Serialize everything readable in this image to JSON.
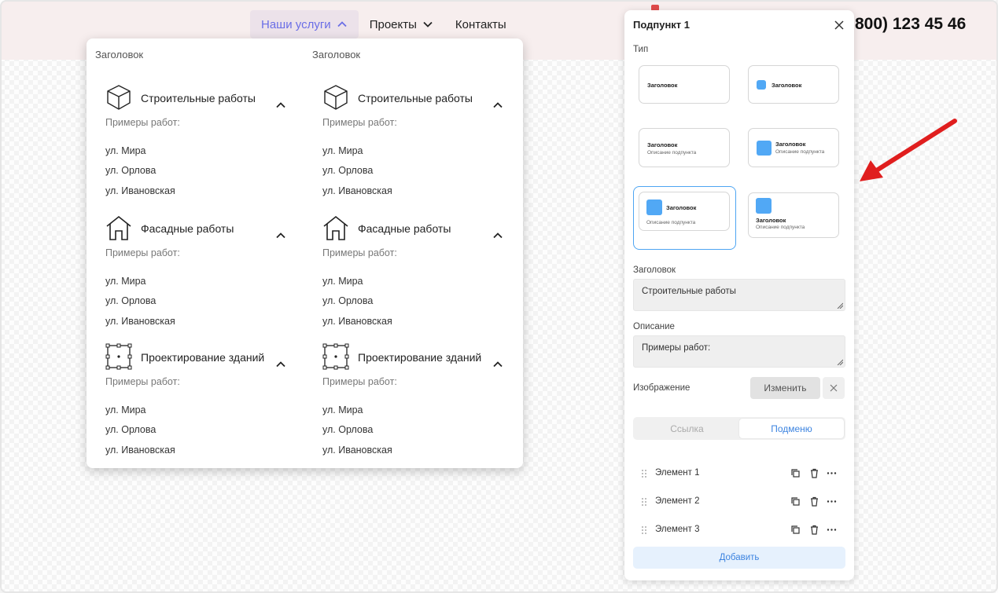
{
  "header": {
    "nav": [
      {
        "label": "Наши услуги",
        "active": true,
        "chevron": "chevron-up-icon"
      },
      {
        "label": "Проекты",
        "active": false,
        "chevron": "chevron-down-icon"
      },
      {
        "label": "Контакты",
        "active": false
      }
    ],
    "phone": "800) 123 45 46"
  },
  "mega_menu": {
    "columns": [
      {
        "heading": "Заголовок",
        "sections": [
          {
            "icon": "cube-icon",
            "title": "Строительные работы",
            "desc": "Примеры работ:",
            "links": [
              "ул. Мира",
              "ул. Орлова",
              "ул. Ивановская"
            ]
          },
          {
            "icon": "house-icon",
            "title": "Фасадные работы",
            "desc": "Примеры работ:",
            "links": [
              "ул. Мира",
              "ул. Орлова",
              "ул. Ивановская"
            ]
          },
          {
            "icon": "blueprint-icon",
            "title": "Проектирование зданий",
            "desc": "Примеры работ:",
            "links": [
              "ул. Мира",
              "ул. Орлова",
              "ул. Ивановская"
            ]
          }
        ]
      },
      {
        "heading": "Заголовок",
        "sections": [
          {
            "icon": "cube-icon",
            "title": "Строительные работы",
            "desc": "Примеры работ:",
            "links": [
              "ул. Мира",
              "ул. Орлова",
              "ул. Ивановская"
            ]
          },
          {
            "icon": "house-icon",
            "title": "Фасадные работы",
            "desc": "Примеры работ:",
            "links": [
              "ул. Мира",
              "ул. Орлова",
              "ул. Ивановская"
            ]
          },
          {
            "icon": "blueprint-icon",
            "title": "Проектирование зданий",
            "desc": "Примеры работ:",
            "links": [
              "ул. Мира",
              "ул. Орлова",
              "ул. Ивановская"
            ]
          }
        ]
      }
    ]
  },
  "panel": {
    "title": "Подпункт 1",
    "type_label": "Тип",
    "type_options": [
      {
        "title": "Заголовок"
      },
      {
        "title": "Заголовок"
      },
      {
        "title": "Заголовок",
        "desc": "Описание подпункта"
      },
      {
        "title": "Заголовок",
        "desc": "Описание подпункта"
      },
      {
        "title": "Заголовок",
        "desc": "Описание подпункта",
        "selected": true
      },
      {
        "title": "Заголовок",
        "desc": "Описание подпункта"
      }
    ],
    "heading_label": "Заголовок",
    "heading_value": "Строительные работы",
    "desc_label": "Описание",
    "desc_value": "Примеры работ:",
    "image_label": "Изображение",
    "change_button": "Изменить",
    "segment": {
      "link": "Ссылка",
      "submenu": "Подменю",
      "active": "submenu"
    },
    "elements": [
      "Элемент 1",
      "Элемент 2",
      "Элемент 3"
    ],
    "add_button": "Добавить"
  },
  "colors": {
    "accent": "#51a8f5",
    "header_bg": "#f7eeee",
    "arrow": "#e01e1e"
  }
}
